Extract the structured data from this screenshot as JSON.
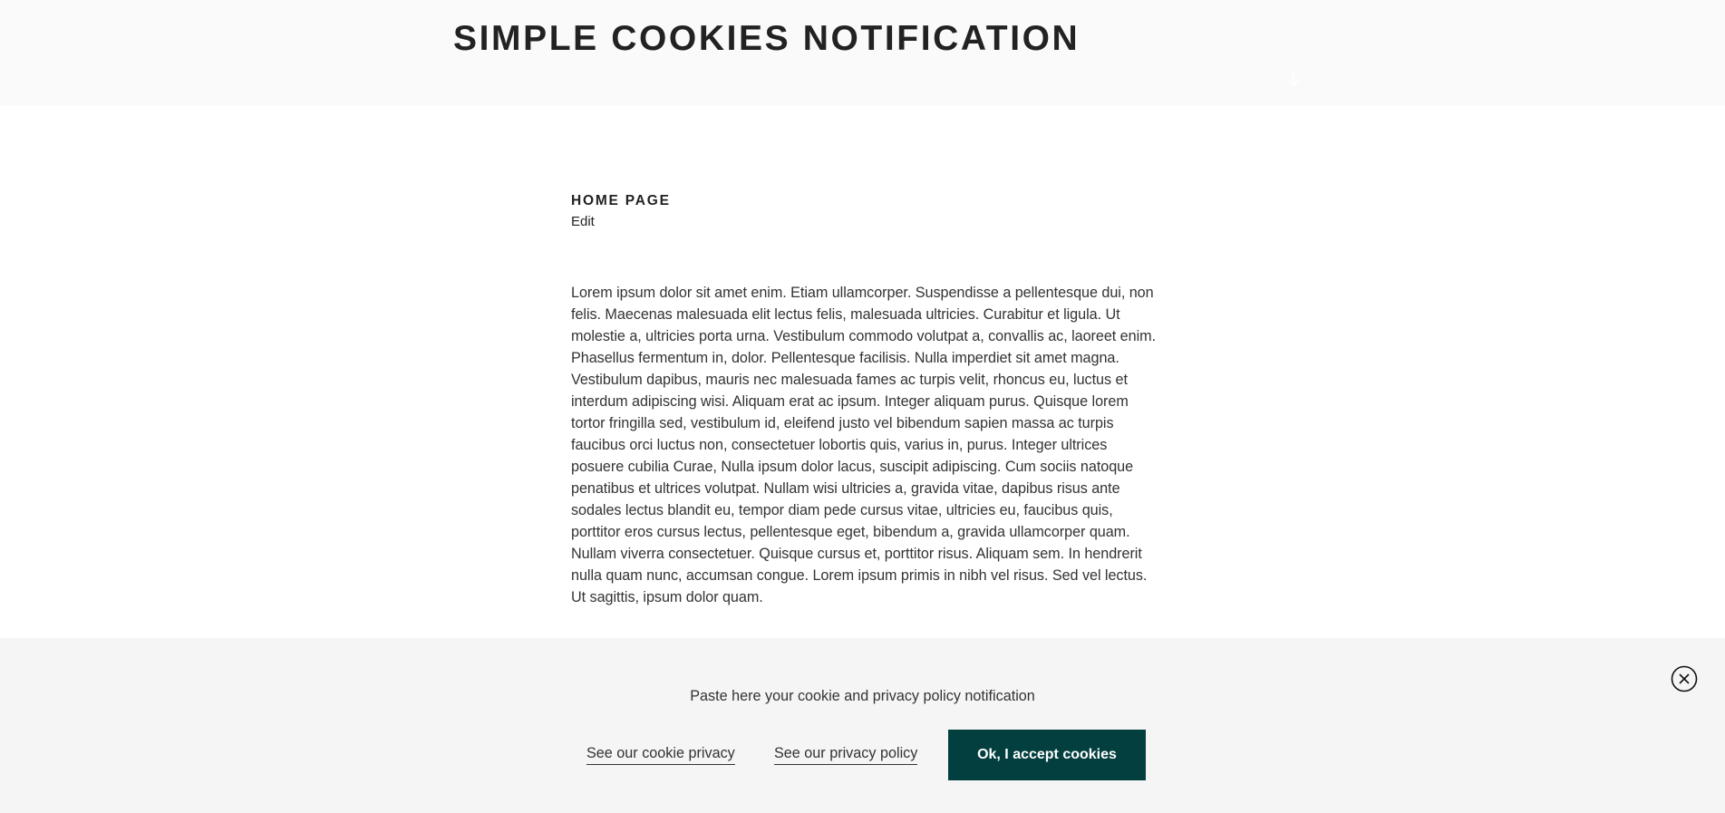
{
  "header": {
    "site_title": "SIMPLE COOKIES NOTIFICATION",
    "scroll_icon": "arrow-down-icon"
  },
  "entry": {
    "title": "HOME PAGE",
    "edit_label": "Edit",
    "body": "Lorem ipsum dolor sit amet enim. Etiam ullamcorper. Suspendisse a pellentesque dui, non felis. Maecenas malesuada elit lectus felis, malesuada ultricies. Curabitur et ligula. Ut molestie a, ultricies porta urna. Vestibulum commodo volutpat a, convallis ac, laoreet enim. Phasellus fermentum in, dolor. Pellentesque facilisis. Nulla imperdiet sit amet magna. Vestibulum dapibus, mauris nec malesuada fames ac turpis velit, rhoncus eu, luctus et interdum adipiscing wisi. Aliquam erat ac ipsum. Integer aliquam purus. Quisque lorem tortor fringilla sed, vestibulum id, eleifend justo vel bibendum sapien massa ac turpis faucibus orci luctus non, consectetuer lobortis quis, varius in, purus. Integer ultrices posuere cubilia Curae, Nulla ipsum dolor lacus, suscipit adipiscing. Cum sociis natoque penatibus et ultrices volutpat. Nullam wisi ultricies a, gravida vitae, dapibus risus ante sodales lectus blandit eu, tempor diam pede cursus vitae, ultricies eu, faucibus quis, porttitor eros cursus lectus, pellentesque eget, bibendum a, gravida ullamcorper quam. Nullam viverra consectetuer. Quisque cursus et, porttitor risus. Aliquam sem. In hendrerit nulla quam nunc, accumsan congue. Lorem ipsum primis in nibh vel risus. Sed vel lectus. Ut sagittis, ipsum dolor quam."
  },
  "cookie_notice": {
    "message": "Paste here your cookie and privacy policy notification",
    "cookie_link_label": "See our cookie privacy",
    "privacy_link_label": "See our privacy policy",
    "accept_label": "Ok, I accept cookies",
    "close_icon": "close-circle-icon",
    "accent_color": "#033f3f",
    "background_color": "#f5f5f5"
  }
}
